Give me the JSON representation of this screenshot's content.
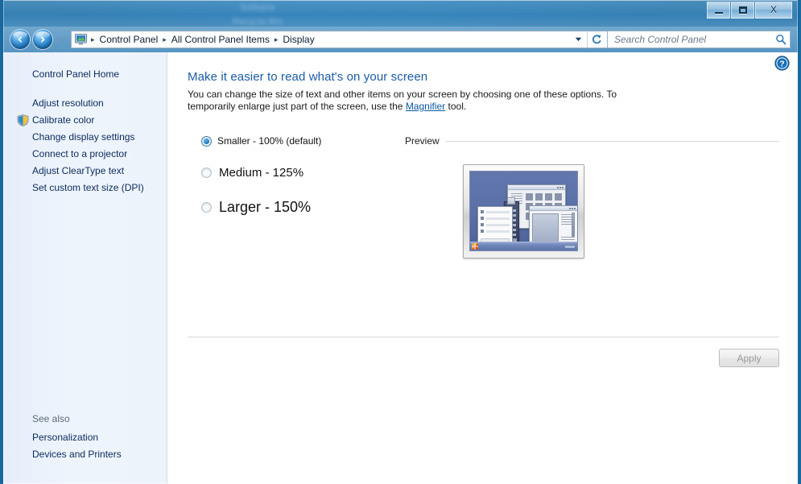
{
  "desktop": {
    "blurred_text_line1": "Solitaire",
    "blurred_text_line2": "Recycle Bin"
  },
  "window": {
    "caption_buttons": {
      "minimize_label": "Minimize",
      "maximize_label": "Maximize",
      "close_label": "X"
    }
  },
  "navbar": {
    "back_label": "Back",
    "forward_label": "Forward",
    "history_dropdown_label": "Recent pages",
    "breadcrumb": {
      "icon": "display-monitor-icon",
      "separator": "▸",
      "items": [
        "Control Panel",
        "All Control Panel Items",
        "Display"
      ]
    },
    "breadcrumb_dropdown_label": "Previous locations",
    "refresh_label": "Refresh",
    "search": {
      "placeholder": "Search Control Panel",
      "value": "",
      "icon": "search-icon"
    }
  },
  "sidebar": {
    "home_label": "Control Panel Home",
    "tasks": [
      {
        "label": "Adjust resolution",
        "icon": null
      },
      {
        "label": "Calibrate color",
        "icon": "uac-shield-icon"
      },
      {
        "label": "Change display settings",
        "icon": null
      },
      {
        "label": "Connect to a projector",
        "icon": null
      },
      {
        "label": "Adjust ClearType text",
        "icon": null
      },
      {
        "label": "Set custom text size (DPI)",
        "icon": null
      }
    ],
    "see_also_label": "See also",
    "see_also": [
      {
        "label": "Personalization"
      },
      {
        "label": "Devices and Printers"
      }
    ]
  },
  "content": {
    "help_label": "Help",
    "title": "Make it easier to read what's on your screen",
    "description_before_link": "You can change the size of text and other items on your screen by choosing one of these options. To temporarily enlarge just part of the screen, use the ",
    "description_link": "Magnifier",
    "description_after_link": " tool.",
    "options": [
      {
        "label": "Smaller - 100% (default)",
        "checked": true,
        "scale": "100%"
      },
      {
        "label": "Medium - 125%",
        "checked": false,
        "scale": "125%"
      },
      {
        "label": "Larger - 150%",
        "checked": false,
        "scale": "150%"
      }
    ],
    "preview": {
      "label": "Preview",
      "image": "monitor-with-windows-preview"
    },
    "apply": {
      "label": "Apply",
      "enabled": false
    }
  },
  "colors": {
    "accent_blue": "#1b5ba8",
    "link_blue": "#0b57a4",
    "sidebar_bg": "#edf3fb",
    "content_bg": "#ffffff",
    "titlebar_glass": "#9bc6ee",
    "preview_desktop": "#5a6fa6",
    "disabled_text": "#9a9a9a"
  }
}
